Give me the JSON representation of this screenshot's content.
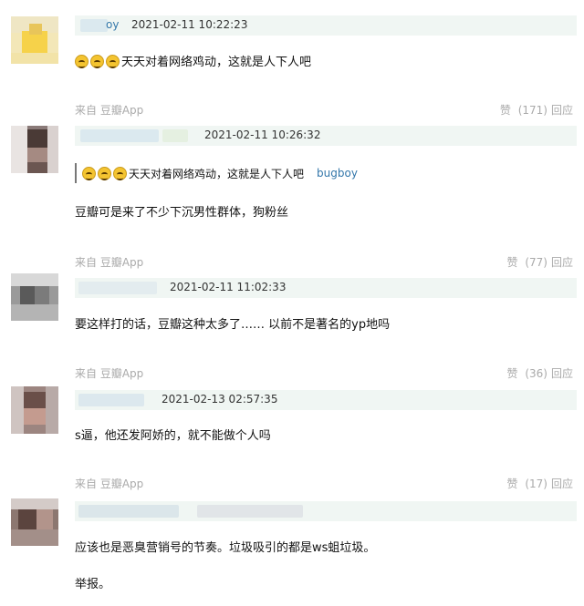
{
  "comments": [
    {
      "username_tail": "oy",
      "time": "2021-02-11 10:22:23",
      "content": "天天对着网络鸡动，这就是人下人吧",
      "emoji_count": 3,
      "source": "来自 豆瓣App",
      "like_label": "赞",
      "like_count": "(171)",
      "reply_label": "回应"
    },
    {
      "time": "2021-02-11 10:26:32",
      "quote_text": "天天对着网络鸡动，这就是人下人吧",
      "quote_author": "bugboy",
      "content": "豆瓣可是来了不少下沉男性群体，狗粉丝",
      "source": "来自 豆瓣App",
      "like_label": "赞",
      "like_count": "(77)",
      "reply_label": "回应"
    },
    {
      "time": "2021-02-11 11:02:33",
      "content": "要这样打的话，豆瓣这种太多了…… 以前不是著名的yp地吗",
      "source": "来自 豆瓣App",
      "like_label": "赞",
      "like_count": "(36)",
      "reply_label": "回应"
    },
    {
      "time": "2021-02-13 02:57:35",
      "content": "s逼，他还发阿娇的，就不能做个人吗",
      "source": "来自 豆瓣App",
      "like_label": "赞",
      "like_count": "(17)",
      "reply_label": "回应"
    },
    {
      "content": "应该也是恶臭营销号的节奏。垃圾吸引的都是ws蛆垃圾。",
      "report": "举报。"
    }
  ]
}
